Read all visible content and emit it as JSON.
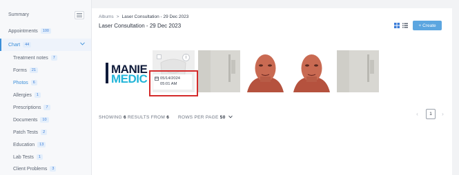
{
  "sidebar": {
    "summary": "Summary",
    "appointments": {
      "label": "Appointments",
      "count": "100"
    },
    "chart": {
      "label": "Chart",
      "count": "44"
    },
    "items": [
      {
        "label": "Treatment notes",
        "count": "7"
      },
      {
        "label": "Forms",
        "count": "21"
      },
      {
        "label": "Photos",
        "count": "6"
      },
      {
        "label": "Allergies",
        "count": "1"
      },
      {
        "label": "Prescriptions",
        "count": "7"
      },
      {
        "label": "Documents",
        "count": "10"
      },
      {
        "label": "Patch Tests",
        "count": "2"
      },
      {
        "label": "Education",
        "count": "13"
      },
      {
        "label": "Lab Tests",
        "count": "1"
      },
      {
        "label": "Client Problems",
        "count": "3"
      }
    ]
  },
  "breadcrumb": {
    "root": "Albums",
    "separator": ">",
    "current": "Laser Consultation - 29 Dec 2023"
  },
  "page_title": "Laser Consultation - 29 Dec 2023",
  "create_label": "Create",
  "create_icon": "plus-icon",
  "logo": {
    "line1": "MANIE",
    "line2": "MEDIC"
  },
  "photo_date": "05/14/2024",
  "photo_time": "05:01 AM",
  "results": {
    "prefix": "SHOWING",
    "count": "6",
    "middle": "RESULTS FROM",
    "total": "6"
  },
  "rows_per_page": {
    "label": "ROWS PER PAGE",
    "value": "50"
  },
  "pagination": {
    "page": "1",
    "prev": "‹",
    "next": "›"
  },
  "colors": {
    "accent": "#5ca6e0",
    "highlight": "#d42a2a",
    "active_nav": "#3b8fd9"
  }
}
